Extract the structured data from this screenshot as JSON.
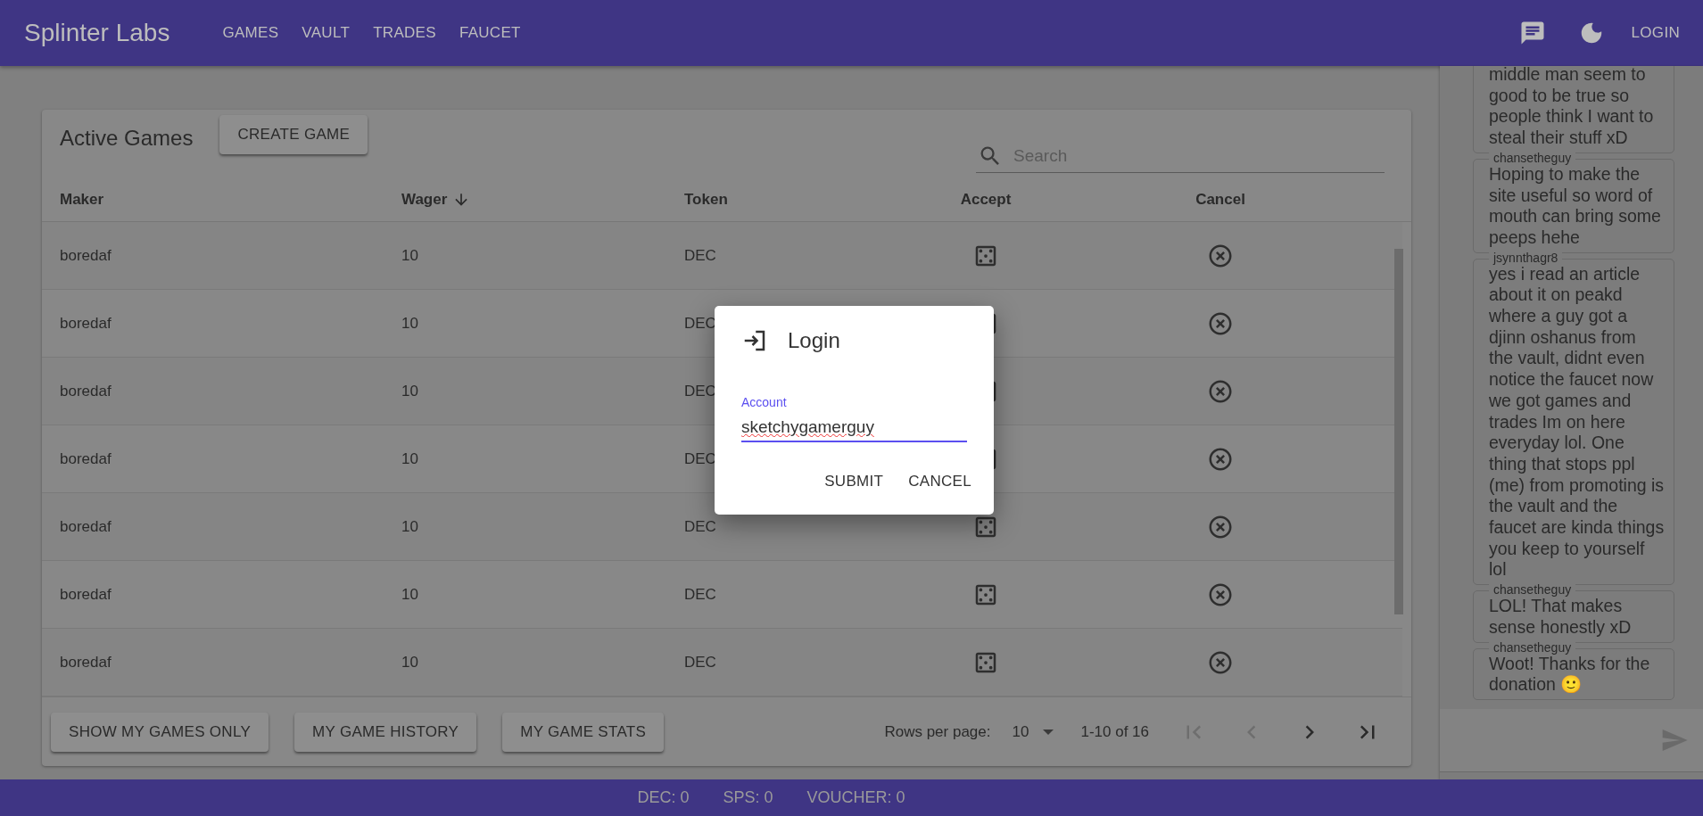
{
  "app_bar": {
    "brand": "Splinter Labs",
    "nav": [
      {
        "label": "GAMES"
      },
      {
        "label": "VAULT"
      },
      {
        "label": "TRADES"
      },
      {
        "label": "FAUCET"
      }
    ],
    "login": "LOGIN"
  },
  "games": {
    "title": "Active Games",
    "create_button": "CREATE GAME",
    "search": {
      "placeholder": "Search"
    },
    "columns": [
      {
        "label": "Maker",
        "sorted": false
      },
      {
        "label": "Wager",
        "sorted": true
      },
      {
        "label": "Token",
        "sorted": false
      },
      {
        "label": "Accept",
        "sorted": false
      },
      {
        "label": "Cancel",
        "sorted": false
      }
    ],
    "rows": [
      {
        "maker": "boredaf",
        "wager": "10",
        "token": "DEC"
      },
      {
        "maker": "boredaf",
        "wager": "10",
        "token": "DEC"
      },
      {
        "maker": "boredaf",
        "wager": "10",
        "token": "DEC"
      },
      {
        "maker": "boredaf",
        "wager": "10",
        "token": "DEC"
      },
      {
        "maker": "boredaf",
        "wager": "10",
        "token": "DEC"
      },
      {
        "maker": "boredaf",
        "wager": "10",
        "token": "DEC"
      },
      {
        "maker": "boredaf",
        "wager": "10",
        "token": "DEC"
      }
    ],
    "buttons": [
      "SHOW MY GAMES ONLY",
      "MY GAME HISTORY",
      "MY GAME STATS"
    ],
    "pagination": {
      "rows_per_page_label": "Rows per page:",
      "rows_per_page": "10",
      "range": "1-10 of 16"
    }
  },
  "chat": {
    "messages": [
      {
        "text": "middle man seem to good to be true so people think I want to steal their stuff xD"
      },
      {
        "author": "chansetheguy",
        "text": "Hoping to make the site useful so word of mouth can bring some peeps hehe"
      },
      {
        "author": "jsynnthagr8",
        "text": "yes i read an article about it on peakd where a guy got a djinn oshanus from the vault, didnt even notice the faucet now we got games and trades Im on here everyday lol. One thing that stops ppl (me) from promoting is the vault and the faucet are kinda things you keep to yourself lol"
      },
      {
        "author": "chansetheguy",
        "text": "LOL! That makes sense honestly xD"
      },
      {
        "author": "chansetheguy",
        "text": "Woot! Thanks for the donation 🙂"
      }
    ]
  },
  "dialog": {
    "title": "Login",
    "field": {
      "label": "Account",
      "value": "sketchygamerguy"
    },
    "buttons": [
      "SUBMIT",
      "CANCEL"
    ]
  },
  "balances": [
    "DEC: 0",
    "SPS: 0",
    "VOUCHER: 0"
  ]
}
